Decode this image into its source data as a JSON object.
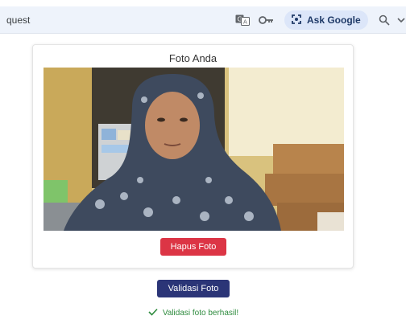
{
  "browser": {
    "url_fragment": "quest",
    "ask_google_label": "Ask Google"
  },
  "card": {
    "title": "Foto Anda",
    "delete_button_label": "Hapus Foto"
  },
  "validate_button_label": "Validasi Foto",
  "status": {
    "message": "Validasi foto berhasil!",
    "icon": "check-icon"
  },
  "colors": {
    "delete_button": "#dc3545",
    "validate_button": "#2b3577",
    "success_text": "#2e8b3e",
    "address_bar": "#eef3fb"
  }
}
